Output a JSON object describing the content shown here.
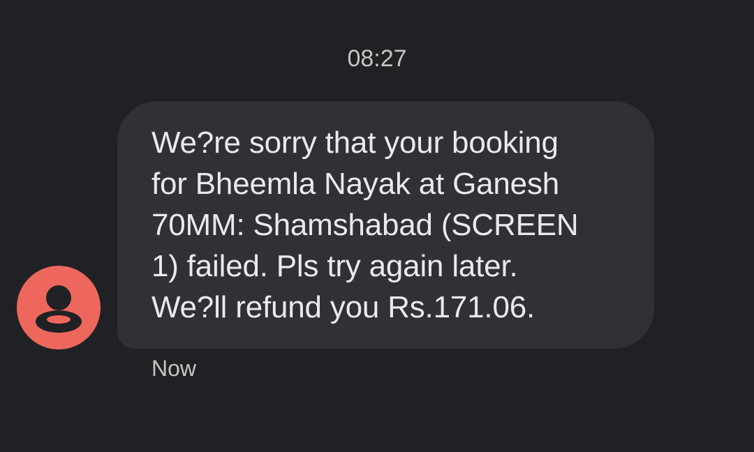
{
  "conversation": {
    "date_header": "08:27",
    "messages": [
      {
        "sender_avatar_icon": "person-icon",
        "avatar_color": "#ee675c",
        "text": "We?re sorry that your booking\nfor Bheemla Nayak at Ganesh\n70MM: Shamshabad (SCREEN\n1) failed. Pls try again later.\nWe?ll refund you Rs.171.06.",
        "time": "Now"
      }
    ]
  },
  "colors": {
    "background": "#202124",
    "bubble": "#303134",
    "text": "#e8eaed",
    "secondary_text": "#c4c7c5"
  }
}
